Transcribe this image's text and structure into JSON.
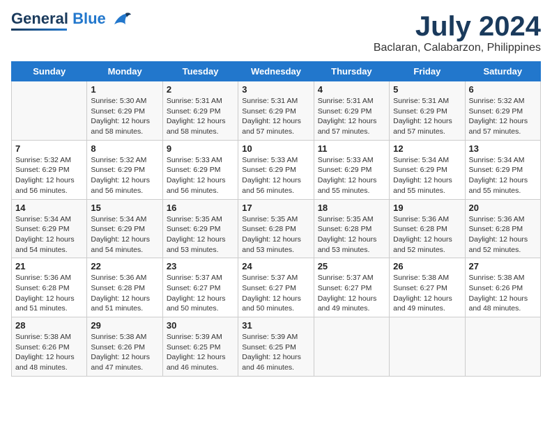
{
  "logo": {
    "line1": "General",
    "line2": "Blue"
  },
  "title": "July 2024",
  "subtitle": "Baclaran, Calabarzon, Philippines",
  "days": [
    "Sunday",
    "Monday",
    "Tuesday",
    "Wednesday",
    "Thursday",
    "Friday",
    "Saturday"
  ],
  "weeks": [
    [
      {
        "num": "",
        "lines": []
      },
      {
        "num": "1",
        "lines": [
          "Sunrise: 5:30 AM",
          "Sunset: 6:29 PM",
          "Daylight: 12 hours",
          "and 58 minutes."
        ]
      },
      {
        "num": "2",
        "lines": [
          "Sunrise: 5:31 AM",
          "Sunset: 6:29 PM",
          "Daylight: 12 hours",
          "and 58 minutes."
        ]
      },
      {
        "num": "3",
        "lines": [
          "Sunrise: 5:31 AM",
          "Sunset: 6:29 PM",
          "Daylight: 12 hours",
          "and 57 minutes."
        ]
      },
      {
        "num": "4",
        "lines": [
          "Sunrise: 5:31 AM",
          "Sunset: 6:29 PM",
          "Daylight: 12 hours",
          "and 57 minutes."
        ]
      },
      {
        "num": "5",
        "lines": [
          "Sunrise: 5:31 AM",
          "Sunset: 6:29 PM",
          "Daylight: 12 hours",
          "and 57 minutes."
        ]
      },
      {
        "num": "6",
        "lines": [
          "Sunrise: 5:32 AM",
          "Sunset: 6:29 PM",
          "Daylight: 12 hours",
          "and 57 minutes."
        ]
      }
    ],
    [
      {
        "num": "7",
        "lines": [
          "Sunrise: 5:32 AM",
          "Sunset: 6:29 PM",
          "Daylight: 12 hours",
          "and 56 minutes."
        ]
      },
      {
        "num": "8",
        "lines": [
          "Sunrise: 5:32 AM",
          "Sunset: 6:29 PM",
          "Daylight: 12 hours",
          "and 56 minutes."
        ]
      },
      {
        "num": "9",
        "lines": [
          "Sunrise: 5:33 AM",
          "Sunset: 6:29 PM",
          "Daylight: 12 hours",
          "and 56 minutes."
        ]
      },
      {
        "num": "10",
        "lines": [
          "Sunrise: 5:33 AM",
          "Sunset: 6:29 PM",
          "Daylight: 12 hours",
          "and 56 minutes."
        ]
      },
      {
        "num": "11",
        "lines": [
          "Sunrise: 5:33 AM",
          "Sunset: 6:29 PM",
          "Daylight: 12 hours",
          "and 55 minutes."
        ]
      },
      {
        "num": "12",
        "lines": [
          "Sunrise: 5:34 AM",
          "Sunset: 6:29 PM",
          "Daylight: 12 hours",
          "and 55 minutes."
        ]
      },
      {
        "num": "13",
        "lines": [
          "Sunrise: 5:34 AM",
          "Sunset: 6:29 PM",
          "Daylight: 12 hours",
          "and 55 minutes."
        ]
      }
    ],
    [
      {
        "num": "14",
        "lines": [
          "Sunrise: 5:34 AM",
          "Sunset: 6:29 PM",
          "Daylight: 12 hours",
          "and 54 minutes."
        ]
      },
      {
        "num": "15",
        "lines": [
          "Sunrise: 5:34 AM",
          "Sunset: 6:29 PM",
          "Daylight: 12 hours",
          "and 54 minutes."
        ]
      },
      {
        "num": "16",
        "lines": [
          "Sunrise: 5:35 AM",
          "Sunset: 6:29 PM",
          "Daylight: 12 hours",
          "and 53 minutes."
        ]
      },
      {
        "num": "17",
        "lines": [
          "Sunrise: 5:35 AM",
          "Sunset: 6:28 PM",
          "Daylight: 12 hours",
          "and 53 minutes."
        ]
      },
      {
        "num": "18",
        "lines": [
          "Sunrise: 5:35 AM",
          "Sunset: 6:28 PM",
          "Daylight: 12 hours",
          "and 53 minutes."
        ]
      },
      {
        "num": "19",
        "lines": [
          "Sunrise: 5:36 AM",
          "Sunset: 6:28 PM",
          "Daylight: 12 hours",
          "and 52 minutes."
        ]
      },
      {
        "num": "20",
        "lines": [
          "Sunrise: 5:36 AM",
          "Sunset: 6:28 PM",
          "Daylight: 12 hours",
          "and 52 minutes."
        ]
      }
    ],
    [
      {
        "num": "21",
        "lines": [
          "Sunrise: 5:36 AM",
          "Sunset: 6:28 PM",
          "Daylight: 12 hours",
          "and 51 minutes."
        ]
      },
      {
        "num": "22",
        "lines": [
          "Sunrise: 5:36 AM",
          "Sunset: 6:28 PM",
          "Daylight: 12 hours",
          "and 51 minutes."
        ]
      },
      {
        "num": "23",
        "lines": [
          "Sunrise: 5:37 AM",
          "Sunset: 6:27 PM",
          "Daylight: 12 hours",
          "and 50 minutes."
        ]
      },
      {
        "num": "24",
        "lines": [
          "Sunrise: 5:37 AM",
          "Sunset: 6:27 PM",
          "Daylight: 12 hours",
          "and 50 minutes."
        ]
      },
      {
        "num": "25",
        "lines": [
          "Sunrise: 5:37 AM",
          "Sunset: 6:27 PM",
          "Daylight: 12 hours",
          "and 49 minutes."
        ]
      },
      {
        "num": "26",
        "lines": [
          "Sunrise: 5:38 AM",
          "Sunset: 6:27 PM",
          "Daylight: 12 hours",
          "and 49 minutes."
        ]
      },
      {
        "num": "27",
        "lines": [
          "Sunrise: 5:38 AM",
          "Sunset: 6:26 PM",
          "Daylight: 12 hours",
          "and 48 minutes."
        ]
      }
    ],
    [
      {
        "num": "28",
        "lines": [
          "Sunrise: 5:38 AM",
          "Sunset: 6:26 PM",
          "Daylight: 12 hours",
          "and 48 minutes."
        ]
      },
      {
        "num": "29",
        "lines": [
          "Sunrise: 5:38 AM",
          "Sunset: 6:26 PM",
          "Daylight: 12 hours",
          "and 47 minutes."
        ]
      },
      {
        "num": "30",
        "lines": [
          "Sunrise: 5:39 AM",
          "Sunset: 6:25 PM",
          "Daylight: 12 hours",
          "and 46 minutes."
        ]
      },
      {
        "num": "31",
        "lines": [
          "Sunrise: 5:39 AM",
          "Sunset: 6:25 PM",
          "Daylight: 12 hours",
          "and 46 minutes."
        ]
      },
      {
        "num": "",
        "lines": []
      },
      {
        "num": "",
        "lines": []
      },
      {
        "num": "",
        "lines": []
      }
    ]
  ]
}
